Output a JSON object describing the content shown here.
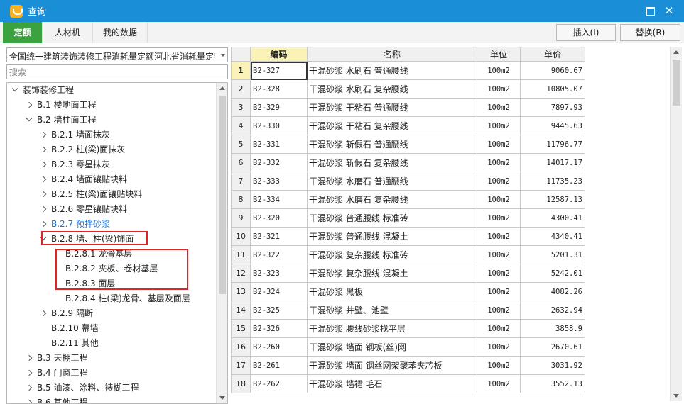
{
  "window": {
    "title": "查询",
    "maximize_icon": "maximize-icon",
    "close_icon": "close-icon"
  },
  "tabs": [
    {
      "label": "定额",
      "active": true
    },
    {
      "label": "人材机",
      "active": false
    },
    {
      "label": "我的数据",
      "active": false
    }
  ],
  "toolbar": {
    "insert_label": "插入(I)",
    "replace_label": "替换(R)"
  },
  "left": {
    "quota_select": "全国统一建筑装饰装修工程消耗量定额河北省消耗量定额",
    "search_placeholder": "搜索"
  },
  "tree": [
    {
      "label": "装饰装修工程",
      "state": "expanded",
      "level": 0
    },
    {
      "label": "B.1 楼地面工程",
      "state": "collapsed",
      "level": 1
    },
    {
      "label": "B.2 墙柱面工程",
      "state": "expanded",
      "level": 1
    },
    {
      "label": "B.2.1 墙面抹灰",
      "state": "collapsed",
      "level": 2
    },
    {
      "label": "B.2.2 柱(梁)面抹灰",
      "state": "collapsed",
      "level": 2
    },
    {
      "label": "B.2.3 零星抹灰",
      "state": "collapsed",
      "level": 2
    },
    {
      "label": "B.2.4 墙面镶贴块料",
      "state": "collapsed",
      "level": 2
    },
    {
      "label": "B.2.5 柱(梁)面镶贴块料",
      "state": "collapsed",
      "level": 2
    },
    {
      "label": "B.2.6 零星镶贴块料",
      "state": "collapsed",
      "level": 2
    },
    {
      "label": "B.2.7 预拌砂浆",
      "state": "collapsed",
      "level": 2,
      "highlight": true
    },
    {
      "label": "B.2.8 墙、柱(梁)饰面",
      "state": "expanded",
      "level": 2
    },
    {
      "label": "B.2.8.1 龙骨基层",
      "state": "leaf",
      "level": 3
    },
    {
      "label": "B.2.8.2 夹板、卷材基层",
      "state": "leaf",
      "level": 3
    },
    {
      "label": "B.2.8.3 面层",
      "state": "leaf",
      "level": 3
    },
    {
      "label": "B.2.8.4 柱(梁)龙骨、基层及面层",
      "state": "leaf",
      "level": 3
    },
    {
      "label": "B.2.9 隔断",
      "state": "collapsed",
      "level": 2
    },
    {
      "label": "B.2.10 幕墙",
      "state": "leaf",
      "level": 2
    },
    {
      "label": "B.2.11 其他",
      "state": "leaf",
      "level": 2
    },
    {
      "label": "B.3 天棚工程",
      "state": "collapsed",
      "level": 1
    },
    {
      "label": "B.4 门窗工程",
      "state": "collapsed",
      "level": 1
    },
    {
      "label": "B.5 油漆、涂料、裱糊工程",
      "state": "collapsed",
      "level": 1
    },
    {
      "label": "B.6 其他工程",
      "state": "collapsed",
      "level": 1
    }
  ],
  "table": {
    "headers": {
      "code": "编码",
      "name": "名称",
      "unit": "单位",
      "price": "单价"
    },
    "rows": [
      {
        "n": "1",
        "code": "B2-327",
        "name": "干混砂浆 水刷石 普通腰线",
        "unit": "100m2",
        "price": "9060.67"
      },
      {
        "n": "2",
        "code": "B2-328",
        "name": "干混砂浆 水刷石 复杂腰线",
        "unit": "100m2",
        "price": "10805.07"
      },
      {
        "n": "3",
        "code": "B2-329",
        "name": "干混砂浆 干粘石 普通腰线",
        "unit": "100m2",
        "price": "7897.93"
      },
      {
        "n": "4",
        "code": "B2-330",
        "name": "干混砂浆 干粘石 复杂腰线",
        "unit": "100m2",
        "price": "9445.63"
      },
      {
        "n": "5",
        "code": "B2-331",
        "name": "干混砂浆 斩假石 普通腰线",
        "unit": "100m2",
        "price": "11796.77"
      },
      {
        "n": "6",
        "code": "B2-332",
        "name": "干混砂浆 斩假石 复杂腰线",
        "unit": "100m2",
        "price": "14017.17"
      },
      {
        "n": "7",
        "code": "B2-333",
        "name": "干混砂浆 水磨石 普通腰线",
        "unit": "100m2",
        "price": "11735.23"
      },
      {
        "n": "8",
        "code": "B2-334",
        "name": "干混砂浆 水磨石 复杂腰线",
        "unit": "100m2",
        "price": "12587.13"
      },
      {
        "n": "9",
        "code": "B2-320",
        "name": "干混砂浆 普通腰线 标准砖",
        "unit": "100m2",
        "price": "4300.41"
      },
      {
        "n": "10",
        "code": "B2-321",
        "name": "干混砂浆 普通腰线 混凝土",
        "unit": "100m2",
        "price": "4340.41"
      },
      {
        "n": "11",
        "code": "B2-322",
        "name": "干混砂浆 复杂腰线 标准砖",
        "unit": "100m2",
        "price": "5201.31"
      },
      {
        "n": "12",
        "code": "B2-323",
        "name": "干混砂浆 复杂腰线 混凝土",
        "unit": "100m2",
        "price": "5242.01"
      },
      {
        "n": "13",
        "code": "B2-324",
        "name": "干混砂浆 黑板",
        "unit": "100m2",
        "price": "4082.26"
      },
      {
        "n": "14",
        "code": "B2-325",
        "name": "干混砂浆 井壁、池壁",
        "unit": "100m2",
        "price": "2632.94"
      },
      {
        "n": "15",
        "code": "B2-326",
        "name": "干混砂浆 腰线砂浆找平层",
        "unit": "100m2",
        "price": "3858.9"
      },
      {
        "n": "16",
        "code": "B2-260",
        "name": "干混砂浆 墙面 钢板(丝)网",
        "unit": "100m2",
        "price": "2670.61"
      },
      {
        "n": "17",
        "code": "B2-261",
        "name": "干混砂浆 墙面 钢丝网架聚苯夹芯板",
        "unit": "100m2",
        "price": "3031.92"
      },
      {
        "n": "18",
        "code": "B2-262",
        "name": "干混砂浆 墙裙 毛石",
        "unit": "100m2",
        "price": "3552.13"
      }
    ]
  }
}
